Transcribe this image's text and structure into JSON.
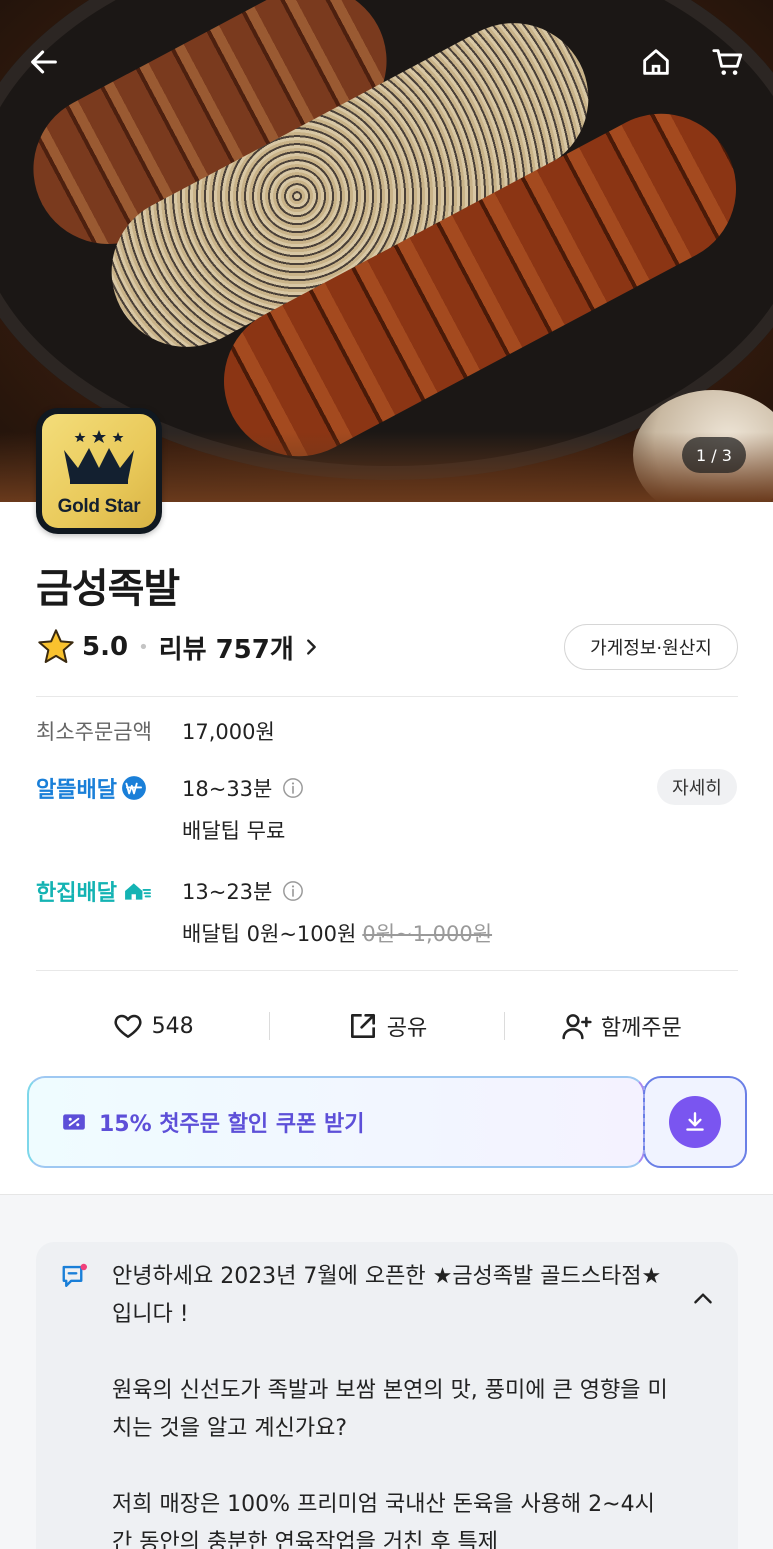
{
  "hero": {
    "image_counter": "1 / 3",
    "logo_text": "Gold Star"
  },
  "store": {
    "name": "금성족발",
    "rating": "5.0",
    "review_label": "리뷰 757개",
    "info_button": "가게정보·원산지"
  },
  "order_info": {
    "min_order_label": "최소주문금액",
    "min_order_value": "17,000원",
    "alttle": {
      "brand": "알뜰배달",
      "time": "18~33분",
      "tip": "배달팁 무료",
      "detail_button": "자세히"
    },
    "hanjip": {
      "brand": "한집배달",
      "time": "13~23분",
      "tip": "배달팁 0원~100원",
      "tip_original": "0원~1,000원"
    }
  },
  "actions": {
    "like_count": "548",
    "share_label": "공유",
    "group_order_label": "함께주문"
  },
  "coupon": {
    "label": "15% 첫주문 할인 쿠폰 받기"
  },
  "notice": {
    "text": "안녕하세요 2023년 7월에 오픈한 ★금성족발 골드스타점★ 입니다 !\n\n원육의 신선도가 족발과 보쌈 본연의 맛, 풍미에 큰 영향을 미치는 것을 알고 계신가요?\n\n저희 매장은 100% 프리미엄 국내산 돈육을 사용해 2~4시간 동안의 충분한 연육작업을 거친 후 특제"
  },
  "colors": {
    "alttle_brand": "#1a7fd8",
    "hanjip_brand": "#14b3b3",
    "coupon_text": "#5d4fd8",
    "download_button": "#7a55f0"
  }
}
